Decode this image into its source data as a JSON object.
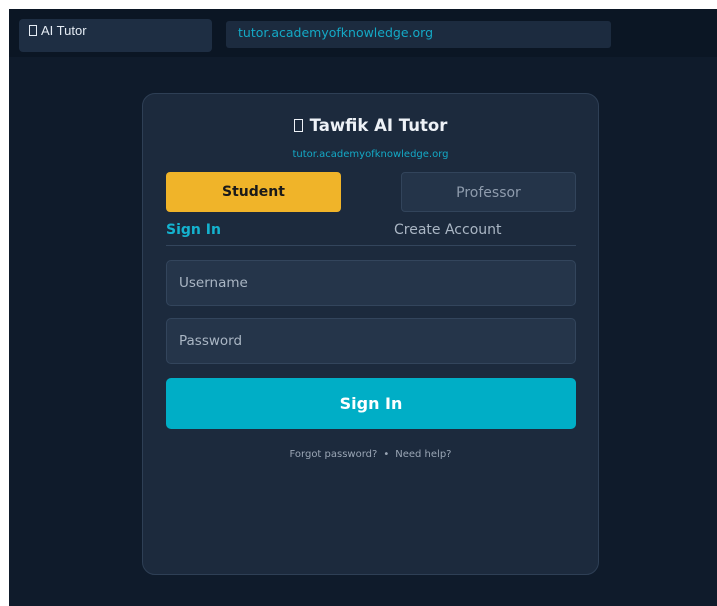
{
  "browser": {
    "tab_title": "AI Tutor",
    "url": "tutor.academyofknowledge.org"
  },
  "login": {
    "title": "Tawfik AI Tutor",
    "subtitle": "tutor.academyofknowledge.org",
    "roles": {
      "student": "Student",
      "professor": "Professor",
      "selected": "Student"
    },
    "auth_tabs": {
      "sign_in": "Sign In",
      "create_account": "Create Account",
      "active": "Sign In"
    },
    "username_placeholder": "Username",
    "password_placeholder": "Password",
    "submit_label": "Sign In",
    "forgot_password": "Forgot password?",
    "separator": "•",
    "need_help": "Need help?"
  },
  "colors": {
    "background": "#0f1b2b",
    "card": "#1c2a3d",
    "accent": "#00aec6",
    "student_selected": "#f0b429"
  }
}
